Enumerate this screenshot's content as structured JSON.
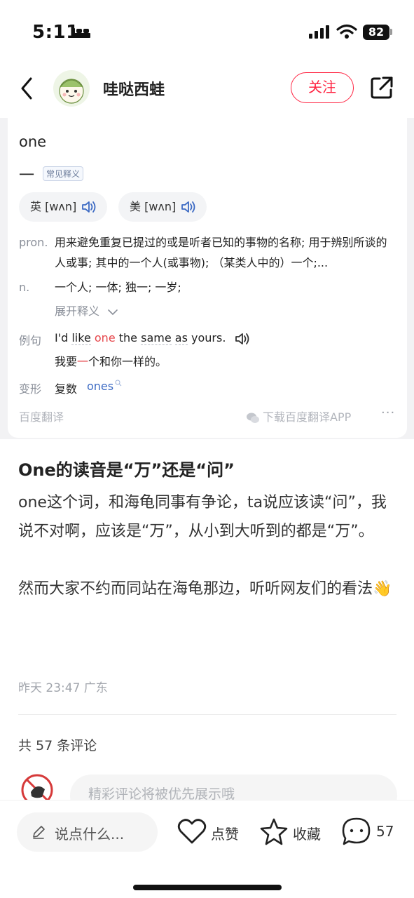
{
  "status_bar": {
    "time": "5:11",
    "battery": "82"
  },
  "header": {
    "user_name": "哇哒西蛙",
    "follow_label": "关注"
  },
  "dictionary": {
    "word": "one",
    "main_meaning": "一",
    "tag": "常见释义",
    "pron_uk": "英 [wʌn]",
    "pron_us": "美 [wʌn]",
    "pron_label": "pron.",
    "pron_text": "用来避免重复已提过的或是听者已知的事物的名称; 用于辨别所谈的人或事; 其中的一个人(或事物); （某类人中的）一个;...",
    "noun_label": "n.",
    "noun_text": "一个人; 一体; 独一; 一岁;",
    "expand_label": "展开释义",
    "example_label": "例句",
    "example_en_pre": "I'd ",
    "example_en_like": "like",
    "example_en_one": "one",
    "example_en_the": "the",
    "example_en_same": "same",
    "example_en_as": "as",
    "example_en_yours": "yours.",
    "example_zh_pre": "我要",
    "example_zh_hl": "一",
    "example_zh_post": "个和你一样的。",
    "variant_label": "变形",
    "variant_type": "复数",
    "variant_word": "ones",
    "footer_left": "百度翻译",
    "footer_right": "下载百度翻译APP",
    "more": "···"
  },
  "note": {
    "title": "One的读音是“万”还是“问”",
    "body": "one这个词，和海龟同事有争论，ta说应该读“问”，我说不对啊，应该是“万”，从小到大听到的都是“万”。\n\n然而大家不约而同站在海龟那边，听听网友们的看法👋",
    "meta": "昨天 23:47 广东"
  },
  "comments": {
    "count_label": "共 57 条评论",
    "input_placeholder": "精彩评论将被优先展示哦"
  },
  "bottom_bar": {
    "say_placeholder": "说点什么...",
    "like_label": "点赞",
    "collect_label": "收藏",
    "comment_count": "57"
  },
  "colors": {
    "accent": "#ff2442",
    "link": "#3d6bc4",
    "highlight": "#e6464b"
  }
}
